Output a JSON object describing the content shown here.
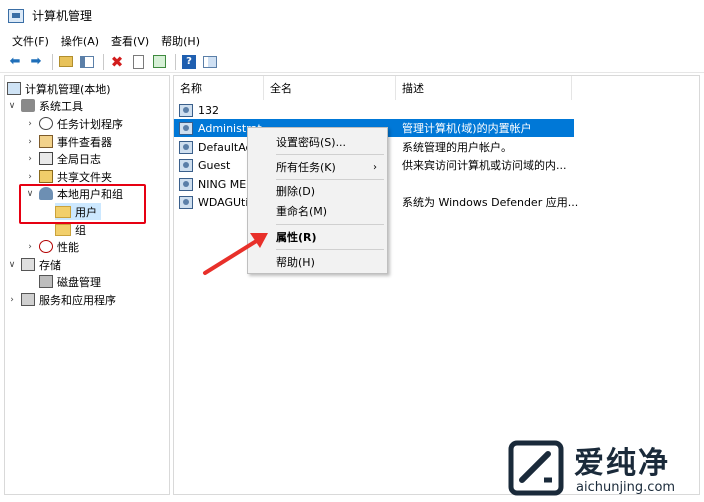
{
  "window": {
    "title": "计算机管理"
  },
  "menu": [
    "文件(F)",
    "操作(A)",
    "查看(V)",
    "帮助(H)"
  ],
  "toolbar": {
    "icons": [
      "back-arrow-icon",
      "forward-arrow-icon",
      "up-folder-icon",
      "show-hide-tree-icon",
      "delete-icon",
      "properties-icon",
      "export-list-icon",
      "help-icon",
      "show-hide-action-pane-icon"
    ],
    "colors": {
      "delete": "#d21d1d",
      "nav": "#1f6fb9"
    }
  },
  "tree": {
    "root": "计算机管理(本地)",
    "system_tools": "系统工具",
    "task_scheduler": "任务计划程序",
    "event_viewer": "事件查看器",
    "global_log": "全局日志",
    "shared_folders": "共享文件夹",
    "local_users_groups": "本地用户和组",
    "users": "用户",
    "groups": "组",
    "performance": "性能",
    "storage": "存储",
    "disk_management": "磁盘管理",
    "services_apps": "服务和应用程序"
  },
  "list": {
    "columns": [
      "名称",
      "全名",
      "描述"
    ],
    "rows": [
      {
        "name": "132",
        "desc": ""
      },
      {
        "name": "Administrat",
        "desc": "管理计算机(域)的内置帐户"
      },
      {
        "name": "DefaultAcc",
        "desc": "系统管理的用户帐户。"
      },
      {
        "name": "Guest",
        "desc": "供来宾访问计算机或访问域的内..."
      },
      {
        "name": "NING ME",
        "desc": ""
      },
      {
        "name": "WDAGUtil",
        "desc": "系统为 Windows Defender 应用..."
      }
    ],
    "selected_row": 1,
    "selection_color": "#0078d7"
  },
  "context_menu": {
    "set_password": "设置密码(S)...",
    "all_tasks": "所有任务(K)",
    "delete": "删除(D)",
    "rename": "重命名(M)",
    "properties": "属性(R)",
    "help": "帮助(H)"
  },
  "annotation": {
    "box_color": "#e60012",
    "arrow_color": "#e8302a"
  },
  "watermark": {
    "title": "爱纯净",
    "url": "aichunjing.com"
  }
}
